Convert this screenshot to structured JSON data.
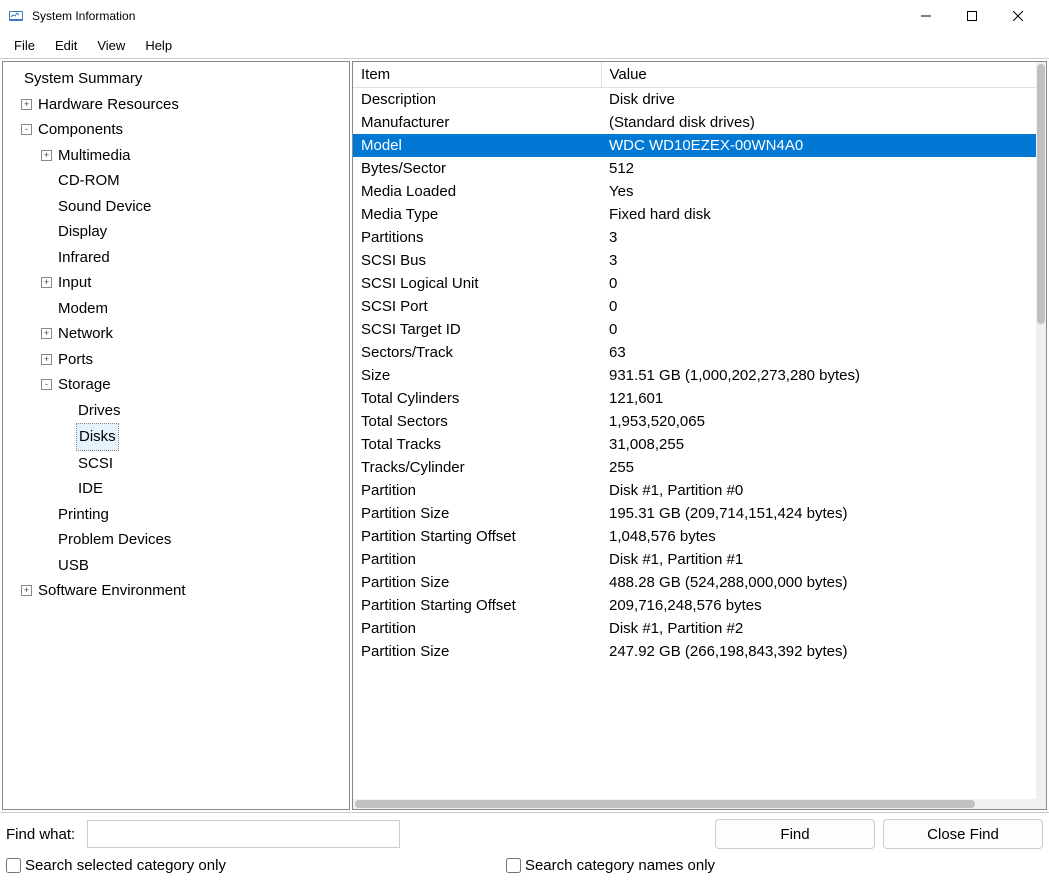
{
  "window": {
    "title": "System Information"
  },
  "menu": {
    "items": [
      "File",
      "Edit",
      "View",
      "Help"
    ]
  },
  "tree": [
    {
      "label": "System Summary",
      "indent": 0,
      "toggle": ""
    },
    {
      "label": "Hardware Resources",
      "indent": 1,
      "toggle": "+"
    },
    {
      "label": "Components",
      "indent": 1,
      "toggle": "-"
    },
    {
      "label": "Multimedia",
      "indent": 2,
      "toggle": "+"
    },
    {
      "label": "CD-ROM",
      "indent": 2,
      "toggle": ""
    },
    {
      "label": "Sound Device",
      "indent": 2,
      "toggle": ""
    },
    {
      "label": "Display",
      "indent": 2,
      "toggle": ""
    },
    {
      "label": "Infrared",
      "indent": 2,
      "toggle": ""
    },
    {
      "label": "Input",
      "indent": 2,
      "toggle": "+"
    },
    {
      "label": "Modem",
      "indent": 2,
      "toggle": ""
    },
    {
      "label": "Network",
      "indent": 2,
      "toggle": "+"
    },
    {
      "label": "Ports",
      "indent": 2,
      "toggle": "+"
    },
    {
      "label": "Storage",
      "indent": 2,
      "toggle": "-"
    },
    {
      "label": "Drives",
      "indent": 3,
      "toggle": ""
    },
    {
      "label": "Disks",
      "indent": 3,
      "toggle": "",
      "selected": true
    },
    {
      "label": "SCSI",
      "indent": 3,
      "toggle": ""
    },
    {
      "label": "IDE",
      "indent": 3,
      "toggle": ""
    },
    {
      "label": "Printing",
      "indent": 2,
      "toggle": ""
    },
    {
      "label": "Problem Devices",
      "indent": 2,
      "toggle": ""
    },
    {
      "label": "USB",
      "indent": 2,
      "toggle": ""
    },
    {
      "label": "Software Environment",
      "indent": 1,
      "toggle": "+"
    }
  ],
  "detail": {
    "headers": {
      "item": "Item",
      "value": "Value"
    },
    "rows": [
      {
        "item": "Description",
        "value": "Disk drive"
      },
      {
        "item": "Manufacturer",
        "value": "(Standard disk drives)"
      },
      {
        "item": "Model",
        "value": "WDC WD10EZEX-00WN4A0",
        "selected": true
      },
      {
        "item": "Bytes/Sector",
        "value": "512"
      },
      {
        "item": "Media Loaded",
        "value": "Yes"
      },
      {
        "item": "Media Type",
        "value": "Fixed hard disk"
      },
      {
        "item": "Partitions",
        "value": "3"
      },
      {
        "item": "SCSI Bus",
        "value": "3"
      },
      {
        "item": "SCSI Logical Unit",
        "value": "0"
      },
      {
        "item": "SCSI Port",
        "value": "0"
      },
      {
        "item": "SCSI Target ID",
        "value": "0"
      },
      {
        "item": "Sectors/Track",
        "value": "63"
      },
      {
        "item": "Size",
        "value": "931.51 GB (1,000,202,273,280 bytes)"
      },
      {
        "item": "Total Cylinders",
        "value": "121,601"
      },
      {
        "item": "Total Sectors",
        "value": "1,953,520,065"
      },
      {
        "item": "Total Tracks",
        "value": "31,008,255"
      },
      {
        "item": "Tracks/Cylinder",
        "value": "255"
      },
      {
        "item": "Partition",
        "value": "Disk #1, Partition #0"
      },
      {
        "item": "Partition Size",
        "value": "195.31 GB (209,714,151,424 bytes)"
      },
      {
        "item": "Partition Starting Offset",
        "value": "1,048,576 bytes"
      },
      {
        "item": "Partition",
        "value": "Disk #1, Partition #1"
      },
      {
        "item": "Partition Size",
        "value": "488.28 GB (524,288,000,000 bytes)"
      },
      {
        "item": "Partition Starting Offset",
        "value": "209,716,248,576 bytes"
      },
      {
        "item": "Partition",
        "value": "Disk #1, Partition #2"
      },
      {
        "item": "Partition Size",
        "value": "247.92 GB (266,198,843,392 bytes)"
      }
    ]
  },
  "findbar": {
    "label": "Find what:",
    "find_btn": "Find",
    "close_btn": "Close Find",
    "checkbox1": "Search selected category only",
    "checkbox2": "Search category names only"
  }
}
